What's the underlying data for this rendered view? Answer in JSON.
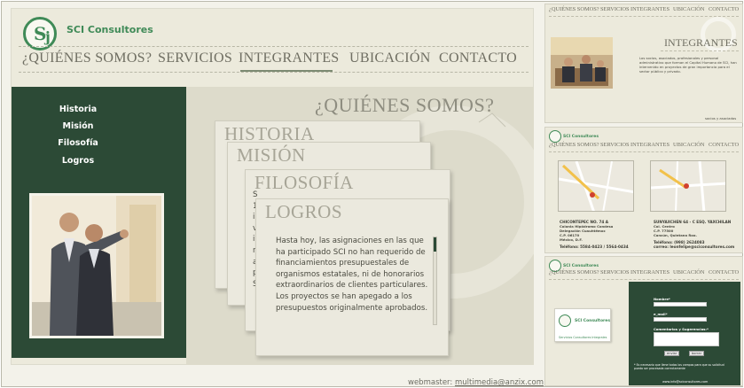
{
  "brand": {
    "name": "SCI Consultores",
    "logo_letters": [
      "S",
      "j"
    ]
  },
  "nav": {
    "items": [
      {
        "label": "¿QUIÉNES SOMOS?",
        "active": false
      },
      {
        "label": "SERVICIOS",
        "active": false
      },
      {
        "label": "INTEGRANTES",
        "active": true
      },
      {
        "label": "UBICACIÓN",
        "active": false
      },
      {
        "label": "CONTACTO",
        "active": false
      }
    ]
  },
  "sidebar": {
    "links": [
      "Historia",
      "Misión",
      "Filosofía",
      "Logros"
    ]
  },
  "content": {
    "title": "¿QUIÉNES SOMOS?",
    "cards": [
      {
        "title": "HISTORIA"
      },
      {
        "title": "MISIÓN"
      },
      {
        "title": "FILOSOFÍA"
      },
      {
        "title": "LOGROS",
        "body": "Hasta hoy, las asignaciones en las que ha participado SCI no han requerido de financiamientos presupuestales de organismos estatales, ni de honorarios extraordinarios de clientes particulares. Los proyectos se han apegado a los presupuestos originalmente aprobados."
      }
    ],
    "peeking_letters": [
      "S",
      "1",
      "i",
      "v",
      "i",
      "n",
      "a",
      "p",
      "S"
    ]
  },
  "footer": {
    "webmaster_label": "webmaster:",
    "webmaster_email": "multimedia@anzix.com"
  },
  "thumbnails": {
    "integrantes": {
      "title": "INTEGRANTES",
      "nav": [
        "¿QUIÉNES SOMOS?",
        "SERVICIOS",
        "INTEGRANTES",
        "UBICACIÓN",
        "CONTACTO"
      ],
      "text": "Los socios, asociados, profesionales y personal administrativo que forman el Capital Humano de SCI, han intervenido en proyectos de gran importancia para el sector público y privado.",
      "footer": "socios y asociados"
    },
    "ubicacion": {
      "brand": "SCI Consultores",
      "nav": [
        "¿QUIÉNES SOMOS?",
        "SERVICIOS",
        "INTEGRANTES",
        "UBICACIÓN",
        "CONTACTO"
      ],
      "office1": {
        "lines": [
          "CHICONTEPEC NO. 74 A",
          "Colonia Hipódromo Condesa",
          "Delegación Cuauhtémoc",
          "C.P. 06170",
          "México, D.F."
        ],
        "phone": "Teléfono: 5584-0423 / 5564-0434"
      },
      "office2": {
        "lines": [
          "SUNYAXCHEN 64 - C ESQ. YAXCHILAN",
          "Col. Centro",
          "C.P. 77500",
          "Cancún, Quintana Roo."
        ],
        "phone": "Teléfono: (998) 2624083",
        "email": "correo: leonfelipe@sciconsultores.com"
      }
    },
    "contacto": {
      "brand": "SCI Consultores",
      "nav": [
        "¿QUIÉNES SOMOS?",
        "SERVICIOS",
        "INTEGRANTES",
        "UBICACIÓN",
        "CONTACTO"
      ],
      "card_brand": "SCI Consultores",
      "card_sub": "Servicios Consultores Integrales",
      "form": {
        "name_label": "Nombre*",
        "email_label": "e_mail*",
        "comments_label": "Comentarios y Sugerencias:*",
        "send": "enviar",
        "clear": "borrar",
        "note": "* Es necesario que llene todos los campos para que su solicitud pueda ser procesada correctamente",
        "footer_email": "www.info@sciconsultores.com"
      }
    }
  },
  "colors": {
    "accent_green": "#3f8a57",
    "dark_green": "#2c4a36",
    "panel": "#eceadc"
  }
}
